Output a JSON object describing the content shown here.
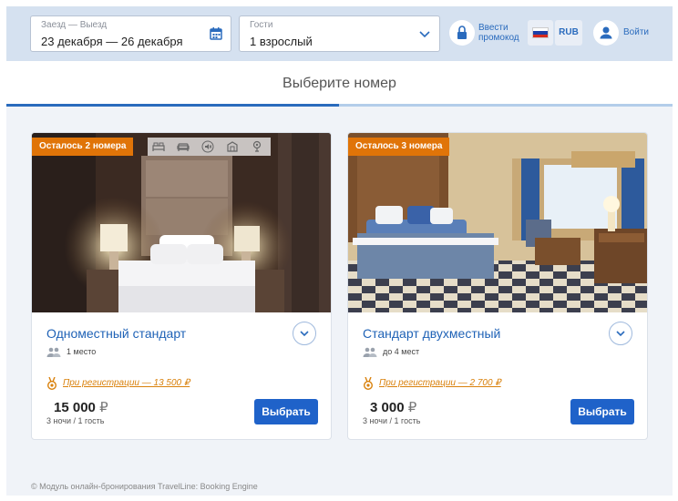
{
  "header": {
    "dates_label": "Заезд — Выезд",
    "dates_value": "23 декабря — 26 декабря",
    "guests_label": "Гости",
    "guests_value": "1 взрослый",
    "promo_label": "Ввести промокод",
    "currency": "RUB",
    "login": "Войти",
    "icons": [
      "calendar-icon",
      "chevron-down-icon",
      "lock-icon",
      "flag-ru-icon",
      "user-icon"
    ]
  },
  "page_title": "Выберите номер",
  "rooms": [
    {
      "badge": "Осталось 2 номера",
      "name": "Одноместный стандарт",
      "capacity": "1 место",
      "registration": "При регистрации — 13 500 ₽",
      "price": "15 000",
      "currency_symbol": "₽",
      "nights": "3 ночи / 1 гость",
      "button": "Выбрать",
      "amenities": [
        "bed-icon",
        "sofa-icon",
        "quiet-icon",
        "safe-icon",
        "hairdryer-icon"
      ]
    },
    {
      "badge": "Осталось 3 номера",
      "name": "Стандарт двухместный",
      "capacity": "до 4 мест",
      "registration": "При регистрации — 2 700 ₽",
      "price": "3 000",
      "currency_symbol": "₽",
      "nights": "3 ночи / 1 гость",
      "button": "Выбрать"
    }
  ],
  "footer": "© Модуль онлайн-бронирования TravelLine: Booking Engine",
  "colors": {
    "accent": "#1f62c9",
    "link": "#1f62b6",
    "badge": "#e07408",
    "header_bg": "#d5e1f0",
    "page_bg": "#f0f3f8"
  }
}
